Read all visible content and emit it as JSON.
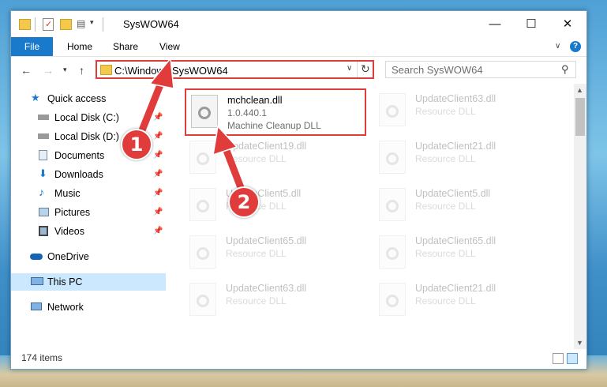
{
  "window": {
    "title": "SysWOW64",
    "minimize": "—",
    "maximize": "☐",
    "close": "✕"
  },
  "ribbon": {
    "tabs": [
      "File",
      "Home",
      "Share",
      "View"
    ],
    "help": "?"
  },
  "address": {
    "path": "C:\\Windows\\SysWOW64",
    "search_placeholder": "Search SysWOW64"
  },
  "nav": {
    "items": [
      {
        "label": "Quick access",
        "icon": "star-icon",
        "pinned": false
      },
      {
        "label": "Local Disk (C:)",
        "icon": "drive-icon",
        "pinned": true
      },
      {
        "label": "Local Disk (D:)",
        "icon": "drive-icon",
        "pinned": true
      },
      {
        "label": "Documents",
        "icon": "documents-icon",
        "pinned": true
      },
      {
        "label": "Downloads",
        "icon": "download-icon",
        "pinned": true
      },
      {
        "label": "Music",
        "icon": "music-icon",
        "pinned": true
      },
      {
        "label": "Pictures",
        "icon": "pictures-icon",
        "pinned": true
      },
      {
        "label": "Videos",
        "icon": "videos-icon",
        "pinned": true
      },
      {
        "label": "OneDrive",
        "icon": "cloud-icon",
        "pinned": false
      },
      {
        "label": "This PC",
        "icon": "computer-icon",
        "pinned": false,
        "selected": true
      },
      {
        "label": "Network",
        "icon": "network-icon",
        "pinned": false
      }
    ]
  },
  "files": {
    "highlighted": {
      "name": "mchclean.dll",
      "version": "1.0.440.1",
      "description": "Machine Cleanup DLL"
    },
    "others": [
      {
        "name": "UpdateClient63.dll",
        "description": "Resource DLL"
      },
      {
        "name": "UpdateClient19.dll",
        "description": "Resource DLL"
      },
      {
        "name": "UpdateClient21.dll",
        "description": "Resource DLL"
      },
      {
        "name": "UpdateClient5.dll",
        "description": "Resource DLL"
      },
      {
        "name": "UpdateClient5.dll",
        "description": "Resource DLL"
      },
      {
        "name": "UpdateClient65.dll",
        "description": "Resource DLL"
      },
      {
        "name": "UpdateClient65.dll",
        "description": "Resource DLL"
      },
      {
        "name": "UpdateClient63.dll",
        "description": "Resource DLL"
      },
      {
        "name": "UpdateClient21.dll",
        "description": "Resource DLL"
      }
    ]
  },
  "status": {
    "item_count": "174 items"
  },
  "annotations": {
    "step1": "1",
    "step2": "2",
    "color": "#e03c3c"
  }
}
